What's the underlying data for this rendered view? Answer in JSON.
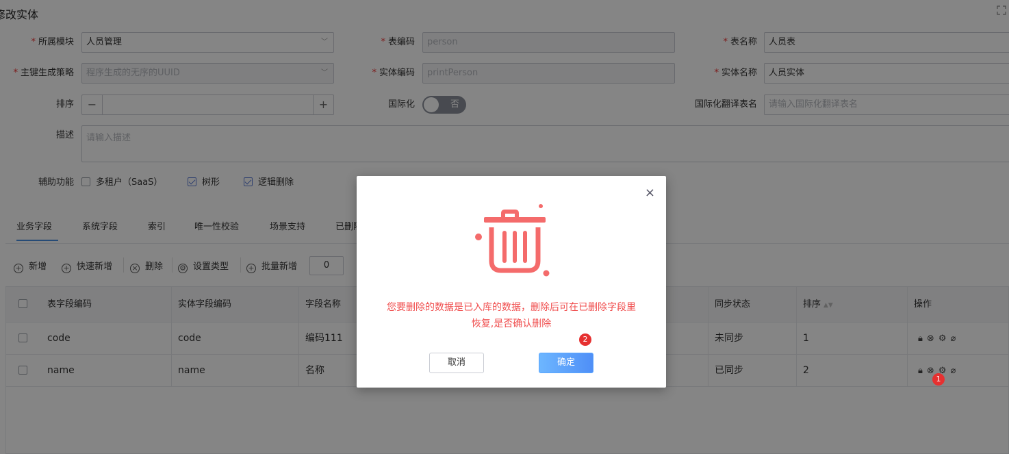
{
  "page": {
    "title": "修改实体"
  },
  "form": {
    "module": {
      "label": "所属模块",
      "value": "人员管理"
    },
    "table_code": {
      "label": "表编码",
      "value": "person"
    },
    "table_name": {
      "label": "表名称",
      "value": "人员表"
    },
    "pk_strategy": {
      "label": "主键生成策略",
      "value": "程序生成的无序的UUID"
    },
    "entity_code": {
      "label": "实体编码",
      "value": "printPerson"
    },
    "entity_name": {
      "label": "实体名称",
      "value": "人员实体"
    },
    "sort": {
      "label": "排序",
      "minus": "−",
      "plus": "+"
    },
    "i18n": {
      "label": "国际化",
      "toggle_text": "否"
    },
    "i18n_table": {
      "label": "国际化翻译表名",
      "placeholder": "请输入国际化翻译表名"
    },
    "description": {
      "label": "描述",
      "placeholder": "请输入描述"
    },
    "aux": {
      "label": "辅助功能",
      "items": [
        {
          "label": "多租户（SaaS）",
          "checked": false
        },
        {
          "label": "树形",
          "checked": true
        },
        {
          "label": "逻辑删除",
          "checked": true
        }
      ]
    }
  },
  "tabs": [
    "业务字段",
    "系统字段",
    "索引",
    "唯一性校验",
    "场景支持",
    "已删除"
  ],
  "toolbar": {
    "add": "新增",
    "quick_add": "快速新增",
    "delete": "删除",
    "set_type": "设置类型",
    "batch_add": "批量新增",
    "count": "0"
  },
  "table": {
    "headers": [
      "表字段编码",
      "实体字段编码",
      "字段名称",
      "同步状态",
      "排序",
      "操作"
    ],
    "rows": [
      {
        "table_code": "code",
        "entity_code": "code",
        "field_name": "编码111",
        "sync": "未同步",
        "sort": "1"
      },
      {
        "table_code": "name",
        "entity_code": "name",
        "field_name": "名称",
        "sync": "已同步",
        "sort": "2"
      }
    ]
  },
  "modal": {
    "message_line1": "您要删除的数据是已入库的数据，删除后可在已删除字段里",
    "message_line2": "恢复,是否确认删除",
    "cancel": "取消",
    "confirm": "确定",
    "close": "×"
  },
  "markers": {
    "one": "1",
    "two": "2"
  },
  "colors": {
    "accent": "#4a90e2",
    "danger": "#f04e4e",
    "trash": "#f46b6b"
  }
}
